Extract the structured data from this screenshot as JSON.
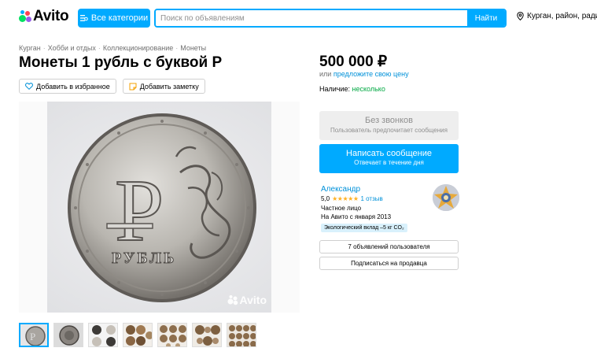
{
  "header": {
    "logo_text": "Avito",
    "categories_button": "Все категории",
    "search_placeholder": "Поиск по объявлениям",
    "search_button": "Найти",
    "location_text": "Курган, район, радиус"
  },
  "breadcrumb": [
    "Курган",
    "Хобби и отдых",
    "Коллекционирование",
    "Монеты"
  ],
  "title": "Монеты 1 рубль с буквой Р",
  "actions": {
    "favorite": "Добавить в избранное",
    "note": "Добавить заметку"
  },
  "photo": {
    "watermark": "Avito",
    "coin_letter": "Р",
    "coin_word": "РУБЛЬ",
    "thumbnail_count": 7,
    "active_thumbnail": 1
  },
  "price": {
    "value": "500 000 ₽",
    "or": "или",
    "offer_link": "предложите свою цену"
  },
  "availability": {
    "label": "Наличие:",
    "value": "несколько"
  },
  "no_calls": {
    "title": "Без звонков",
    "subtitle": "Пользователь предпочитает сообщения"
  },
  "message_button": {
    "title": "Написать сообщение",
    "subtitle": "Отвечает в течение дня"
  },
  "seller": {
    "name": "Александр",
    "rating": "5,0",
    "stars": "★★★★★",
    "reviews": "1 отзыв",
    "type": "Частное лицо",
    "since": "На Авито с января 2013",
    "eco_badge": "Экологический вклад –5 кг CO₂"
  },
  "seller_buttons": {
    "listings": "7 объявлений пользователя",
    "subscribe": "Подписаться на продавца"
  },
  "colors": {
    "accent": "#00aaff",
    "link": "#0091d9",
    "green": "#00a842",
    "star": "#ffb021"
  }
}
